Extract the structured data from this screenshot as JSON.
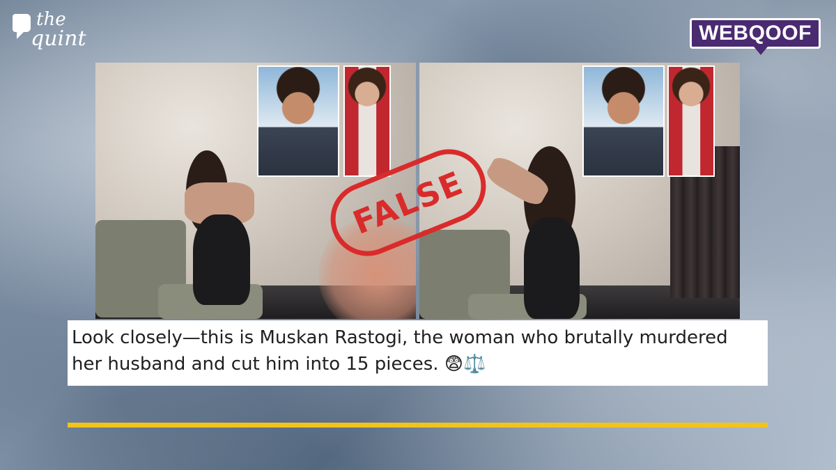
{
  "brand": {
    "logo_line1": "the",
    "logo_line2": "quint"
  },
  "badge": {
    "label": "WEBQOOF"
  },
  "stamp": {
    "label": "FALSE",
    "color": "#d92b2b"
  },
  "caption": {
    "text": "Look closely—this is Muskan Rastogi, the woman who brutally murdered her husband and cut him into 15 pieces.",
    "emojis": "😨⚖️"
  },
  "colors": {
    "badge_bg": "#4a2a70",
    "accent_rule": "#f2c31b"
  }
}
